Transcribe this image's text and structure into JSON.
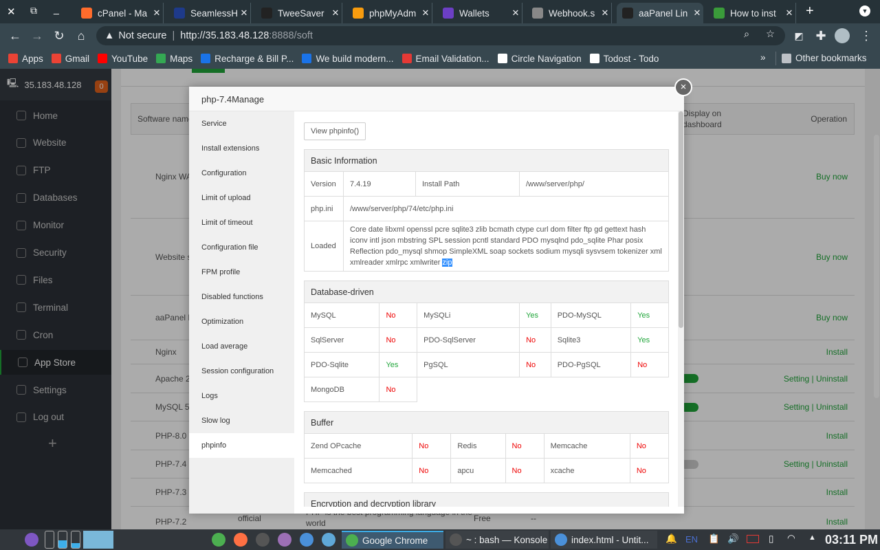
{
  "browser": {
    "tabs": [
      {
        "title": "cPanel - Ma",
        "icon": "cpanel-icon",
        "color": "#ff6c2c"
      },
      {
        "title": "SeamlessHi",
        "icon": "seamless-icon",
        "color": "#1e3a8a"
      },
      {
        "title": "TweeSaver",
        "icon": "bt-icon",
        "color": "#222"
      },
      {
        "title": "phpMyAdm",
        "icon": "phpmyadmin-icon",
        "color": "#f89c0e"
      },
      {
        "title": "Wallets",
        "icon": "wallets-icon",
        "color": "#6c3fc5"
      },
      {
        "title": "Webhook.s",
        "icon": "webhook-icon",
        "color": "#888"
      },
      {
        "title": "aaPanel Lin",
        "icon": "bt-icon",
        "color": "#222"
      },
      {
        "title": "How to inst",
        "icon": "howto-icon",
        "color": "#3a9b3a"
      }
    ],
    "not_secure": "Not secure",
    "url_host": "http://35.183.48.128",
    "url_rest": ":8888/soft",
    "bookmarks": [
      {
        "label": "Apps",
        "color": "#ea4335"
      },
      {
        "label": "Gmail",
        "color": "#ea4335"
      },
      {
        "label": "YouTube",
        "color": "#ff0000"
      },
      {
        "label": "Maps",
        "color": "#34a853"
      },
      {
        "label": "Recharge & Bill P...",
        "color": "#1a73e8"
      },
      {
        "label": "We build modern...",
        "color": "#1a73e8"
      },
      {
        "label": "Email Validation...",
        "color": "#e53935"
      },
      {
        "label": "Circle Navigation",
        "color": "#fff"
      },
      {
        "label": "Todost - Todo",
        "color": "#fff"
      }
    ],
    "more": "»",
    "other_bookmarks": "Other bookmarks"
  },
  "panel": {
    "server": "35.183.48.128",
    "badge": "0",
    "nav": [
      "Home",
      "Website",
      "FTP",
      "Databases",
      "Monitor",
      "Security",
      "Files",
      "Terminal",
      "Cron",
      "App Store",
      "Settings",
      "Log out"
    ],
    "add": "+",
    "table_header": {
      "name": "Software name",
      "display": "Display on dashboard",
      "operation": "Operation"
    },
    "rows": [
      {
        "name": "Nginx WAF",
        "op": "Buy now"
      },
      {
        "name": "Website s",
        "op": "Buy now"
      },
      {
        "name": "aaPanel M",
        "op": "Buy now"
      },
      {
        "name": "Nginx",
        "op": "Install"
      },
      {
        "name": "Apache 2.",
        "op": "Setting | Uninstall"
      },
      {
        "name": "MySQL 5.",
        "op": "Setting | Uninstall"
      },
      {
        "name": "PHP-8.0",
        "op": "Install"
      },
      {
        "name": "PHP-7.4",
        "op": "Setting | Uninstall"
      },
      {
        "name": "PHP-7.3",
        "op": "Install"
      },
      {
        "name": "PHP-7.2",
        "op": "Install",
        "type": "official",
        "desc": "PHP is the best programming language in the world",
        "price": "Free",
        "expire": "--"
      }
    ]
  },
  "modal": {
    "title": "php-7.4Manage",
    "close": "×",
    "nav": [
      "Service",
      "Install extensions",
      "Configuration",
      "Limit of upload",
      "Limit of timeout",
      "Configuration file",
      "FPM profile",
      "Disabled functions",
      "Optimization",
      "Load average",
      "Session configuration",
      "Logs",
      "Slow log",
      "phpinfo"
    ],
    "active_nav": "phpinfo",
    "view_button": "View phpinfo()",
    "basic": {
      "title": "Basic Information",
      "version_label": "Version",
      "version": "7.4.19",
      "path_label": "Install Path",
      "path": "/www/server/php/",
      "ini_label": "php.ini",
      "ini": "/www/server/php/74/etc/php.ini",
      "loaded_label": "Loaded",
      "loaded": "Core date libxml openssl pcre sqlite3 zlib bcmath ctype curl dom filter ftp gd gettext hash iconv intl json mbstring SPL session pcntl standard PDO mysqlnd pdo_sqlite Phar posix Reflection pdo_mysql shmop SimpleXML soap sockets sodium mysqli sysvsem tokenizer xml xmlreader xmlrpc xmlwriter",
      "loaded_selected": "zip"
    },
    "db": {
      "title": "Database-driven",
      "rows": [
        [
          [
            "MySQL",
            "No"
          ],
          [
            "MySQLi",
            "Yes"
          ],
          [
            "PDO-MySQL",
            "Yes"
          ]
        ],
        [
          [
            "SqlServer",
            "No"
          ],
          [
            "PDO-SqlServer",
            "No"
          ],
          [
            "Sqlite3",
            "Yes"
          ]
        ],
        [
          [
            "PDO-Sqlite",
            "Yes"
          ],
          [
            "PgSQL",
            "No"
          ],
          [
            "PDO-PgSQL",
            "No"
          ]
        ],
        [
          [
            "MongoDB",
            "No"
          ]
        ]
      ]
    },
    "buffer": {
      "title": "Buffer",
      "rows": [
        [
          [
            "Zend OPcache",
            "No"
          ],
          [
            "Redis",
            "No"
          ],
          [
            "Memcache",
            "No"
          ]
        ],
        [
          [
            "Memcached",
            "No"
          ],
          [
            "apcu",
            "No"
          ],
          [
            "xcache",
            "No"
          ]
        ]
      ]
    },
    "crypto": {
      "title": "Encryption and decryption library"
    }
  },
  "taskbar": {
    "tasks": [
      "Google Chrome",
      "~ : bash — Konsole",
      "index.html - Untit..."
    ],
    "lang": "EN",
    "clock": "03:11 PM"
  }
}
